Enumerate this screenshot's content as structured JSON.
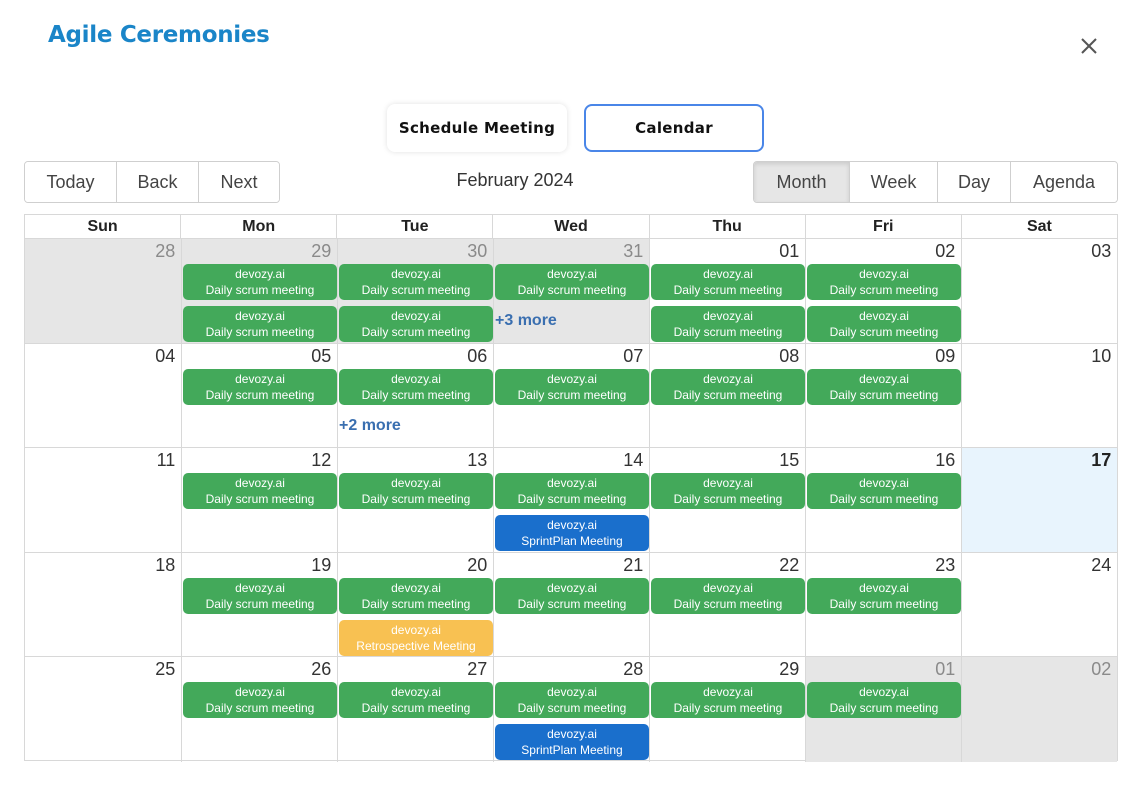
{
  "dialog": {
    "title": "Agile Ceremonies",
    "close_icon": "close-icon"
  },
  "tabs": {
    "schedule_label": "Schedule Meeting",
    "calendar_label": "Calendar",
    "active": "Calendar"
  },
  "toolbar": {
    "nav": [
      "Today",
      "Back",
      "Next"
    ],
    "month_label": "February 2024",
    "views": [
      "Month",
      "Week",
      "Day",
      "Agenda"
    ],
    "active_view": "Month"
  },
  "weekdays": [
    "Sun",
    "Mon",
    "Tue",
    "Wed",
    "Thu",
    "Fri",
    "Sat"
  ],
  "colors": {
    "scrum": "#43a95a",
    "sprint": "#1a6fcc",
    "retro": "#f8c152",
    "accent": "#1a85c8",
    "today_bg": "#e8f4fd",
    "off_bg": "#e6e6e6"
  },
  "weeks": [
    {
      "days": [
        {
          "num": "28",
          "off": true,
          "events": []
        },
        {
          "num": "29",
          "off": true,
          "events": [
            {
              "org": "devozy.ai",
              "title": "Daily scrum meeting",
              "color": "green"
            },
            {
              "org": "devozy.ai",
              "title": "Daily scrum meeting",
              "color": "green"
            }
          ]
        },
        {
          "num": "30",
          "off": true,
          "events": [
            {
              "org": "devozy.ai",
              "title": "Daily scrum meeting",
              "color": "green"
            },
            {
              "org": "devozy.ai",
              "title": "Daily scrum meeting",
              "color": "green"
            }
          ]
        },
        {
          "num": "31",
          "off": true,
          "events": [
            {
              "org": "devozy.ai",
              "title": "Daily scrum meeting",
              "color": "green"
            }
          ],
          "more": "+3 more"
        },
        {
          "num": "01",
          "events": [
            {
              "org": "devozy.ai",
              "title": "Daily scrum meeting",
              "color": "green"
            },
            {
              "org": "devozy.ai",
              "title": "Daily scrum meeting",
              "color": "green"
            }
          ]
        },
        {
          "num": "02",
          "events": [
            {
              "org": "devozy.ai",
              "title": "Daily scrum meeting",
              "color": "green"
            },
            {
              "org": "devozy.ai",
              "title": "Daily scrum meeting",
              "color": "green"
            }
          ]
        },
        {
          "num": "03",
          "events": []
        }
      ]
    },
    {
      "days": [
        {
          "num": "04",
          "events": []
        },
        {
          "num": "05",
          "events": [
            {
              "org": "devozy.ai",
              "title": "Daily scrum meeting",
              "color": "green"
            }
          ]
        },
        {
          "num": "06",
          "events": [
            {
              "org": "devozy.ai",
              "title": "Daily scrum meeting",
              "color": "green"
            }
          ],
          "more": "+2 more"
        },
        {
          "num": "07",
          "events": [
            {
              "org": "devozy.ai",
              "title": "Daily scrum meeting",
              "color": "green"
            }
          ]
        },
        {
          "num": "08",
          "events": [
            {
              "org": "devozy.ai",
              "title": "Daily scrum meeting",
              "color": "green"
            }
          ]
        },
        {
          "num": "09",
          "events": [
            {
              "org": "devozy.ai",
              "title": "Daily scrum meeting",
              "color": "green"
            }
          ]
        },
        {
          "num": "10",
          "events": []
        }
      ]
    },
    {
      "days": [
        {
          "num": "11",
          "events": []
        },
        {
          "num": "12",
          "events": [
            {
              "org": "devozy.ai",
              "title": "Daily scrum meeting",
              "color": "green"
            }
          ]
        },
        {
          "num": "13",
          "events": [
            {
              "org": "devozy.ai",
              "title": "Daily scrum meeting",
              "color": "green"
            }
          ]
        },
        {
          "num": "14",
          "events": [
            {
              "org": "devozy.ai",
              "title": "Daily scrum meeting",
              "color": "green"
            },
            {
              "org": "devozy.ai",
              "title": "SprintPlan Meeting",
              "color": "blue"
            }
          ]
        },
        {
          "num": "15",
          "events": [
            {
              "org": "devozy.ai",
              "title": "Daily scrum meeting",
              "color": "green"
            }
          ]
        },
        {
          "num": "16",
          "events": [
            {
              "org": "devozy.ai",
              "title": "Daily scrum meeting",
              "color": "green"
            }
          ]
        },
        {
          "num": "17",
          "today": true,
          "events": []
        }
      ]
    },
    {
      "days": [
        {
          "num": "18",
          "events": []
        },
        {
          "num": "19",
          "events": [
            {
              "org": "devozy.ai",
              "title": "Daily scrum meeting",
              "color": "green"
            }
          ]
        },
        {
          "num": "20",
          "events": [
            {
              "org": "devozy.ai",
              "title": "Daily scrum meeting",
              "color": "green"
            },
            {
              "org": "devozy.ai",
              "title": "Retrospective Meeting",
              "color": "yellow"
            }
          ]
        },
        {
          "num": "21",
          "events": [
            {
              "org": "devozy.ai",
              "title": "Daily scrum meeting",
              "color": "green"
            }
          ]
        },
        {
          "num": "22",
          "events": [
            {
              "org": "devozy.ai",
              "title": "Daily scrum meeting",
              "color": "green"
            }
          ]
        },
        {
          "num": "23",
          "events": [
            {
              "org": "devozy.ai",
              "title": "Daily scrum meeting",
              "color": "green"
            }
          ]
        },
        {
          "num": "24",
          "events": []
        }
      ]
    },
    {
      "days": [
        {
          "num": "25",
          "events": []
        },
        {
          "num": "26",
          "events": [
            {
              "org": "devozy.ai",
              "title": "Daily scrum meeting",
              "color": "green"
            }
          ]
        },
        {
          "num": "27",
          "events": [
            {
              "org": "devozy.ai",
              "title": "Daily scrum meeting",
              "color": "green"
            }
          ]
        },
        {
          "num": "28",
          "events": [
            {
              "org": "devozy.ai",
              "title": "Daily scrum meeting",
              "color": "green"
            },
            {
              "org": "devozy.ai",
              "title": "SprintPlan Meeting",
              "color": "blue"
            }
          ]
        },
        {
          "num": "29",
          "events": [
            {
              "org": "devozy.ai",
              "title": "Daily scrum meeting",
              "color": "green"
            }
          ]
        },
        {
          "num": "01",
          "off": true,
          "events": [
            {
              "org": "devozy.ai",
              "title": "Daily scrum meeting",
              "color": "green"
            }
          ]
        },
        {
          "num": "02",
          "off": true,
          "events": []
        }
      ]
    }
  ]
}
